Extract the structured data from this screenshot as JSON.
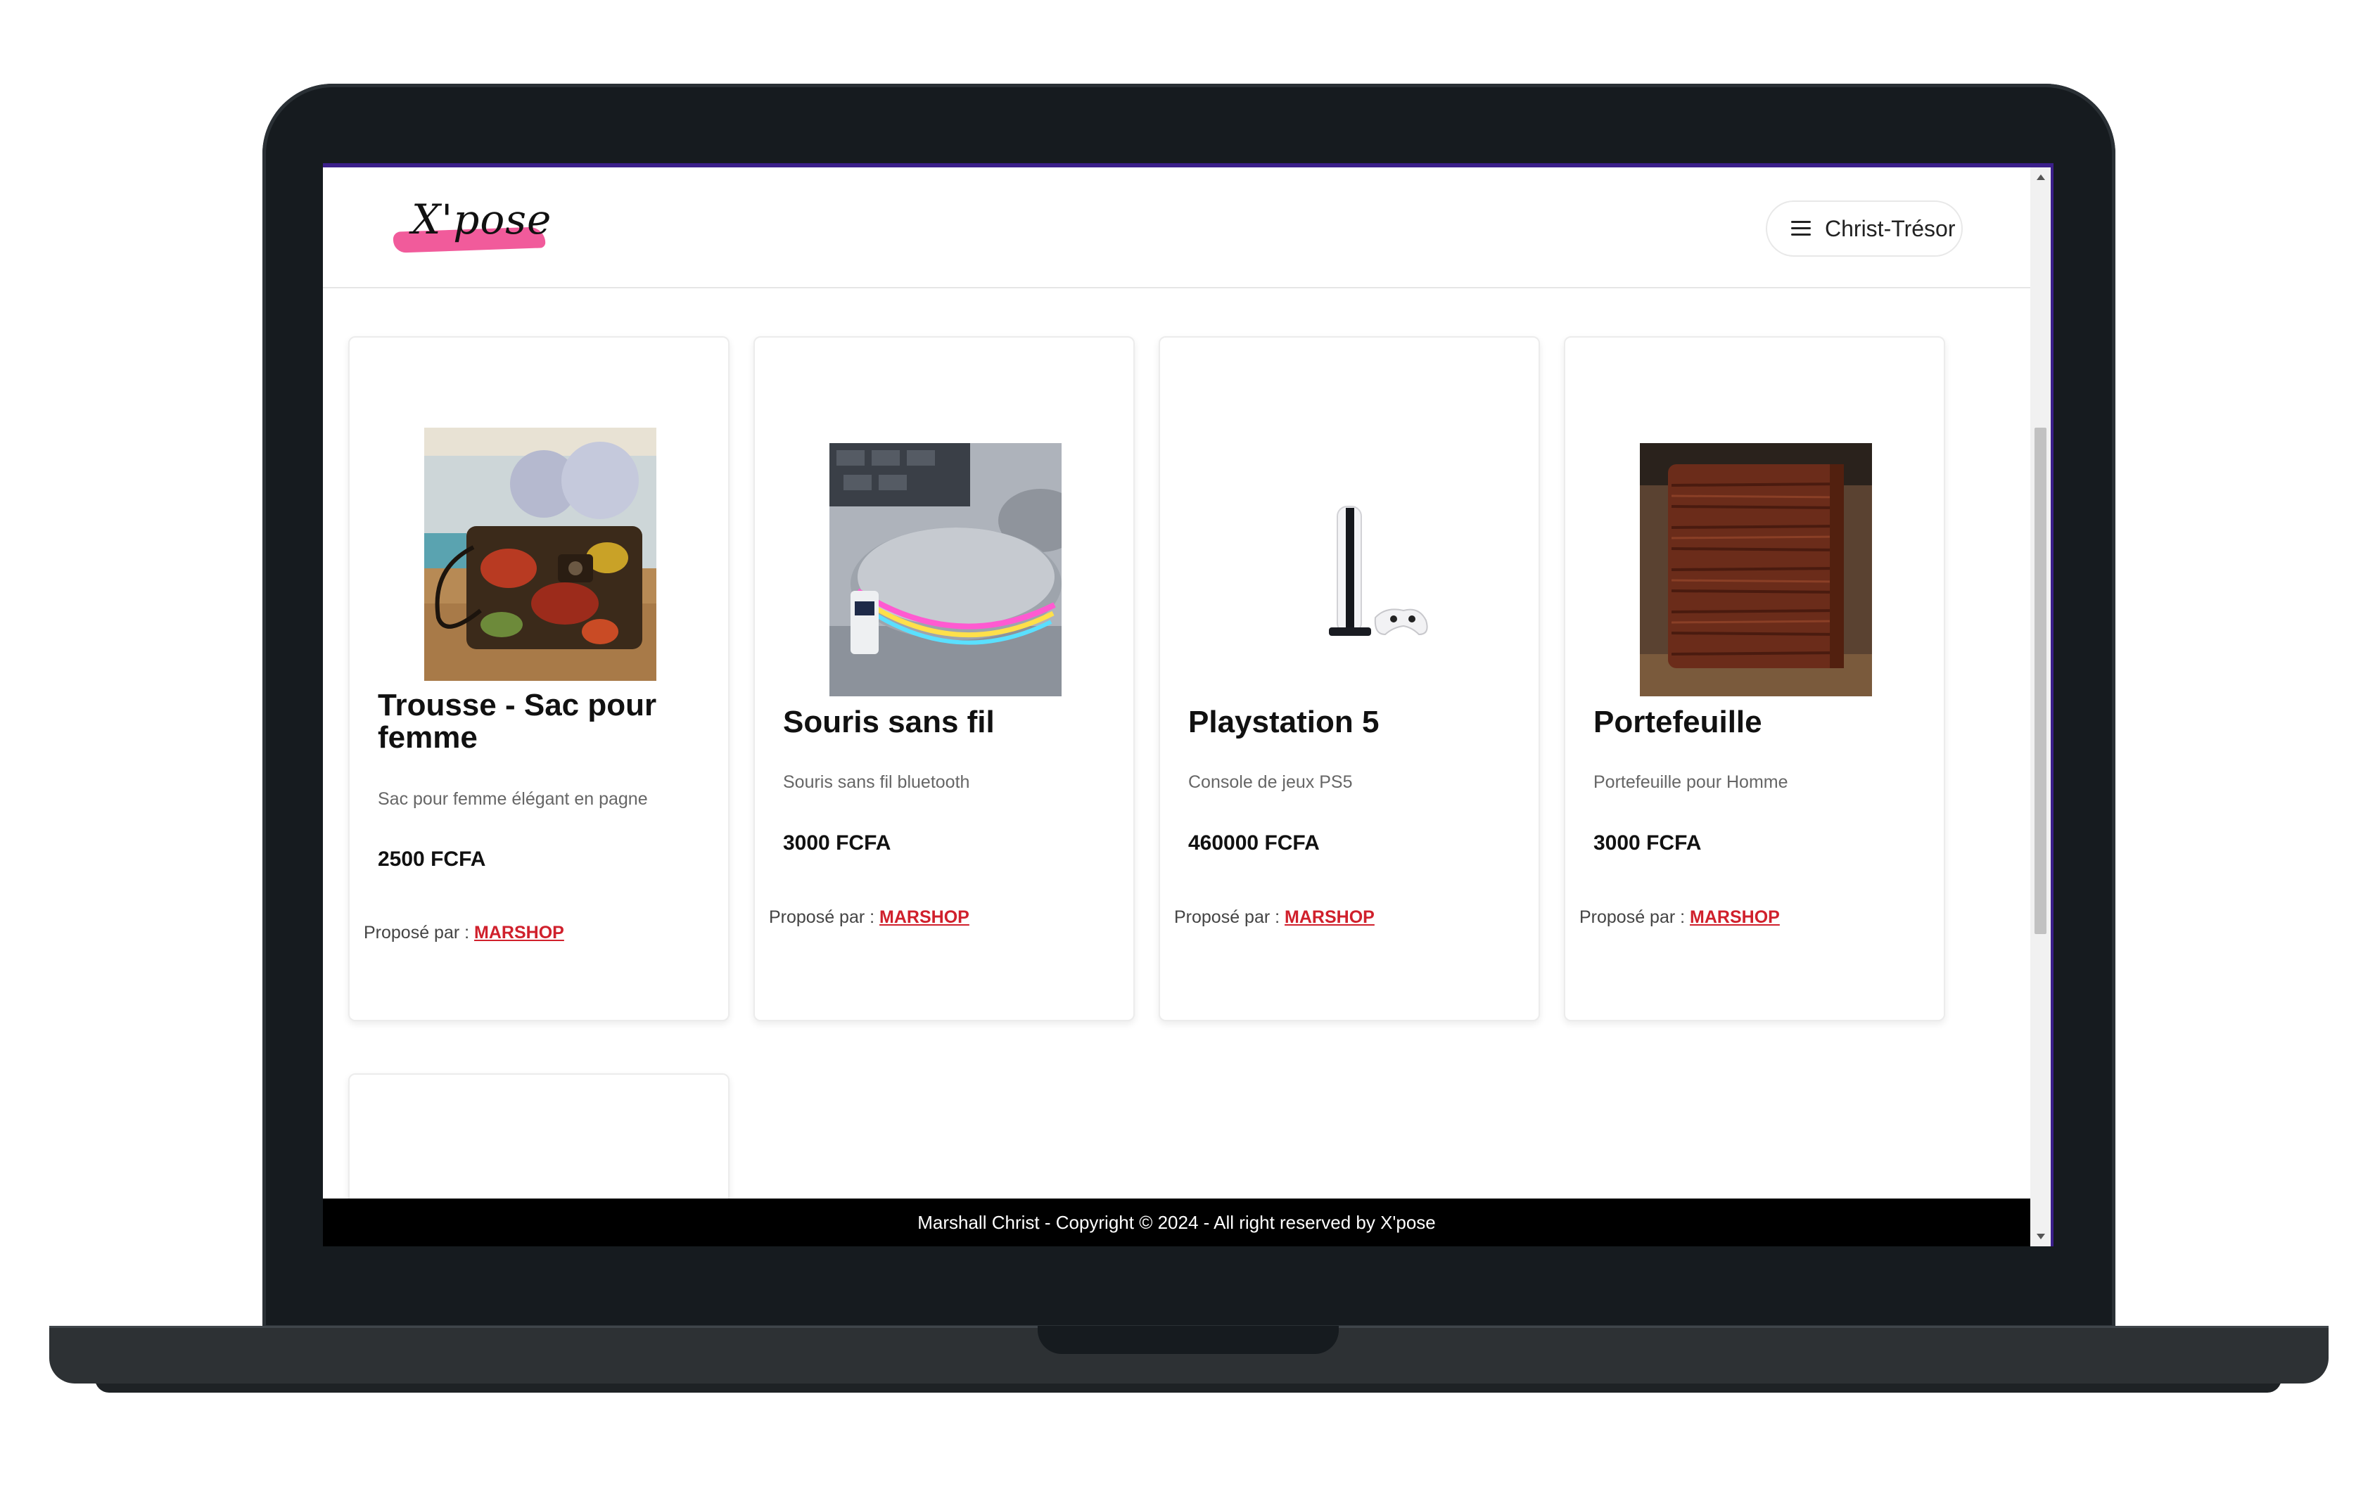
{
  "header": {
    "logo_text": "X'pose",
    "user_menu_label": "Christ-Trésor"
  },
  "products": [
    {
      "title": "Trousse - Sac pour femme",
      "description": "Sac pour femme élégant en pagne",
      "price": "2500 FCFA",
      "vendor_prefix": "Proposé par :",
      "vendor_name": "MARSHOP"
    },
    {
      "title": "Souris sans fil",
      "description": "Souris sans fil bluetooth",
      "price": "3000 FCFA",
      "vendor_prefix": "Proposé par :",
      "vendor_name": "MARSHOP"
    },
    {
      "title": "Playstation 5",
      "description": "Console de jeux PS5",
      "price": "460000 FCFA",
      "vendor_prefix": "Proposé par :",
      "vendor_name": "MARSHOP"
    },
    {
      "title": "Portefeuille",
      "description": "Portefeuille pour Homme",
      "price": "3000 FCFA",
      "vendor_prefix": "Proposé par :",
      "vendor_name": "MARSHOP"
    }
  ],
  "footer": {
    "text": "Marshall Christ - Copyright © 2024 - All right reserved by X'pose"
  },
  "colors": {
    "accent_pink": "#f15b9b",
    "vendor_link": "#d0202c",
    "footer_bg": "#000000"
  }
}
